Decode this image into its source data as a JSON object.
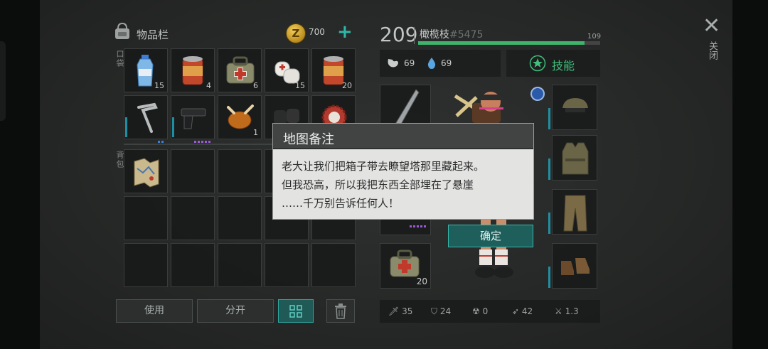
{
  "inventory": {
    "title": "物品栏",
    "coins": "700",
    "coin_symbol": "Z",
    "pocket_label": "口袋",
    "backpack_label": "背包",
    "pocket_row1": [
      {
        "name": "water-bottle",
        "count": "15"
      },
      {
        "name": "canned-food",
        "count": "4"
      },
      {
        "name": "med-bag",
        "count": "6"
      },
      {
        "name": "bandage",
        "count": "15"
      },
      {
        "name": "canned-food",
        "count": "20"
      }
    ],
    "pocket_row2": [
      {
        "name": "crowbar",
        "count": ""
      },
      {
        "name": "pistol",
        "count": ""
      },
      {
        "name": "roast-chicken",
        "count": "1"
      },
      {
        "name": "gloves",
        "count": ""
      },
      {
        "name": "bottle-cap",
        "count": ""
      }
    ]
  },
  "buttons": {
    "use": "使用",
    "split": "分开"
  },
  "player": {
    "level": "209",
    "name": "橄榄枝",
    "id": "#5475",
    "xp_max": "109",
    "hunger": "69",
    "thirst": "69",
    "skills_label": "技能"
  },
  "equipment_bottom": {
    "count": "20"
  },
  "stats": {
    "attack": "35",
    "defense": "24",
    "radiation": "0",
    "speed": "42",
    "attack_speed": "1.3"
  },
  "close": {
    "label": "关闭"
  },
  "dialog": {
    "title": "地图备注",
    "line1": "老大让我们把箱子带去瞭望塔那里藏起来。",
    "line2": "但我恐高，所以我把东西全部埋在了悬崖",
    "line3": "……千万别告诉任何人！",
    "ok": "确定"
  },
  "colors": {
    "accent": "#2fb7a8",
    "xp": "#3fb46a",
    "skill": "#3ec07a"
  }
}
